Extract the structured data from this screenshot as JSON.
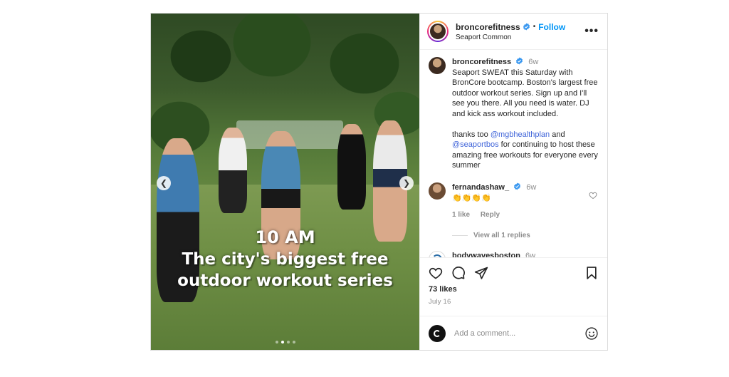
{
  "media": {
    "overlay_line1": "10 AM",
    "overlay_line2": "The city's biggest free",
    "overlay_line3": "outdoor workout series",
    "carousel_total": 4,
    "carousel_active": 2
  },
  "header": {
    "username": "broncorefitness",
    "separator": "•",
    "follow_label": "Follow",
    "location": "Seaport Common",
    "more_label": "•••"
  },
  "caption": {
    "username": "broncorefitness",
    "time": "6w",
    "text_part1": "Seaport SWEAT this Saturday with BronCore bootcamp.  Boston's largest free outdoor workout series.  Sign up and I'll see you there. All you need is water. DJ and kick ass workout included.\n\nthanks too ",
    "mention1": "@mgbhealthplan",
    "text_part2": " and ",
    "mention2": "@seaportbos",
    "text_part3": " for continuing to host these amazing free workouts for everyone every summer"
  },
  "comments": [
    {
      "username": "fernandashaw_",
      "time": "6w",
      "text": "👏👏👏👏",
      "likes_label": "1 like",
      "reply_label": "Reply",
      "view_replies": "View all 1 replies"
    },
    {
      "username": "bodywavesboston",
      "time": "6w",
      "text": "🔥🔥🔥"
    }
  ],
  "actions": {
    "likes": "73 likes",
    "date": "July 16"
  },
  "add_comment": {
    "placeholder": "Add a comment..."
  },
  "colors": {
    "follow_blue": "#0095f6",
    "verified_blue": "#3897f0",
    "muted_text": "#8e8e8e"
  },
  "icons": [
    "verified-badge-icon",
    "more-options-icon",
    "heart-icon",
    "comment-icon",
    "share-icon",
    "bookmark-icon",
    "emoji-icon",
    "chevron-left-icon",
    "chevron-right-icon"
  ]
}
